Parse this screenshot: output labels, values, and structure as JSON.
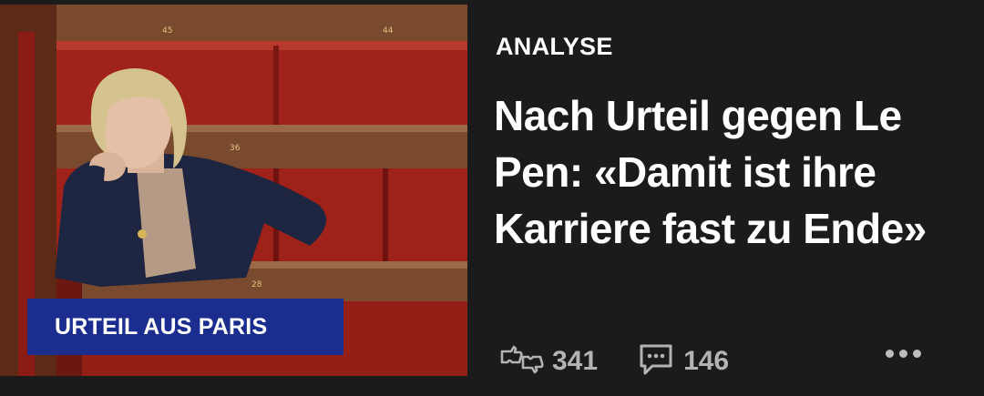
{
  "article": {
    "image_tag": "URTEIL AUS PARIS",
    "kicker": "ANALYSE",
    "headline": "Nach Urteil gegen Le Pen: «Damit ist ihre Karriere fast zu Ende»",
    "reactions_count": "341",
    "comments_count": "146"
  },
  "icons": {
    "reactions": "thumbs-up-down-icon",
    "comments": "comment-bubble-icon",
    "more": "more-options-icon"
  },
  "colors": {
    "background": "#1b1b1b",
    "tag_background": "#1b2d8f",
    "seat_red": "#8b1a14",
    "text": "#ffffff",
    "meta_text": "#b3b3b3"
  }
}
